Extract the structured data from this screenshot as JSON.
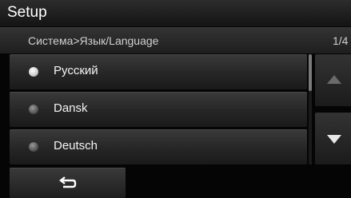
{
  "header": {
    "title": "Setup"
  },
  "breadcrumb": {
    "path": "Система>Язык/Language",
    "page_indicator": "1/4"
  },
  "language_list": {
    "items": [
      {
        "label": "Русский",
        "selected": true
      },
      {
        "label": "Dansk",
        "selected": false
      },
      {
        "label": "Deutsch",
        "selected": false
      }
    ]
  },
  "navigation": {
    "scroll_up_icon": "triangle-up-icon",
    "scroll_down_icon": "triangle-down-icon",
    "back_icon": "return-arrow-icon"
  }
}
